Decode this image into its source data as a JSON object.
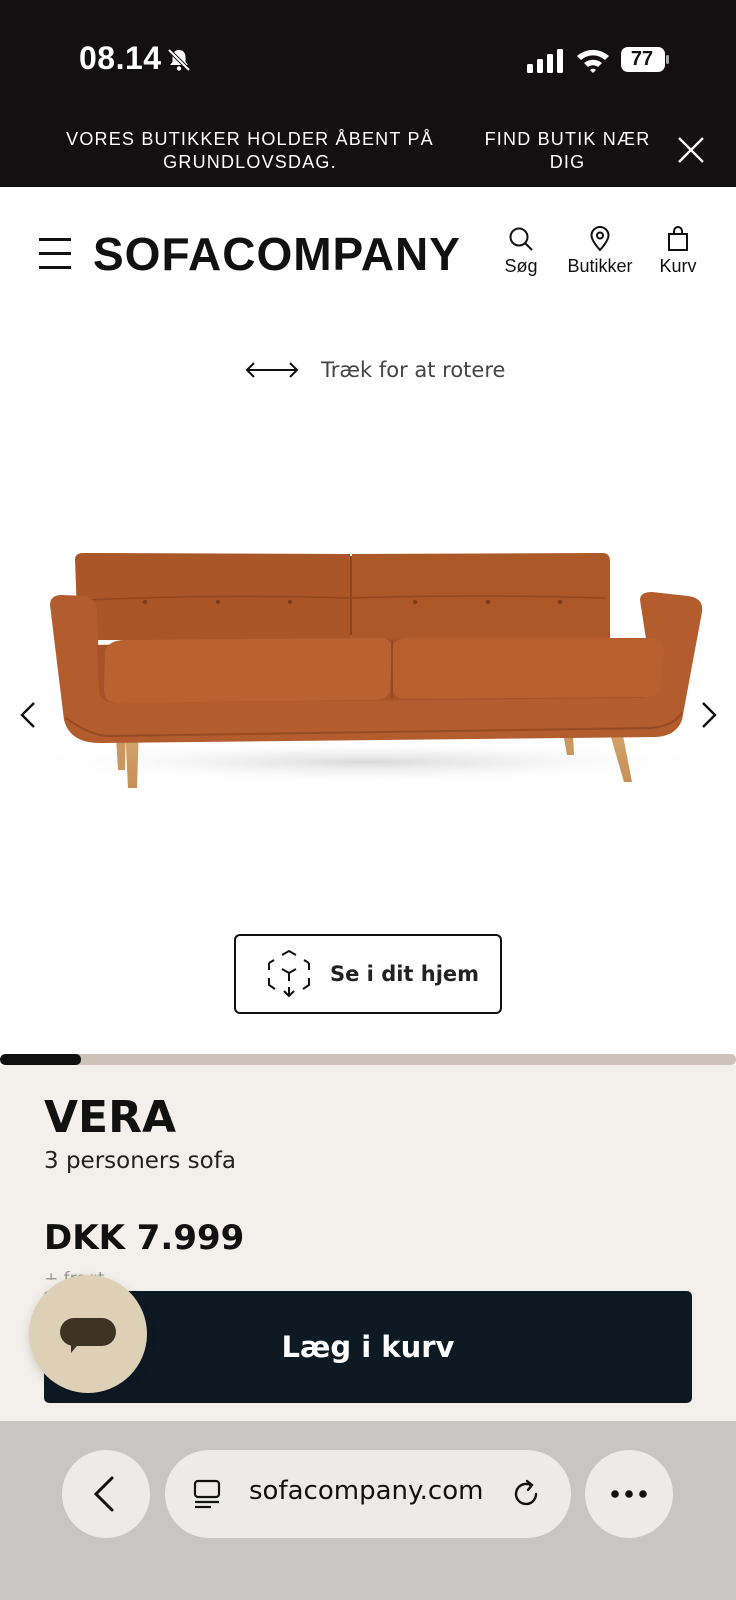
{
  "status_bar": {
    "time": "08.14",
    "battery": "77"
  },
  "banner": {
    "message": "VORES BUTIKKER HOLDER ÅBENT PÅ GRUNDLOVSDAG.",
    "find_store": "FIND BUTIK NÆR DIG"
  },
  "header": {
    "logo": "SOFACOMPANY",
    "search_label": "Søg",
    "stores_label": "Butikker",
    "cart_label": "Kurv"
  },
  "viewer": {
    "rotate_hint": "Træk for at rotere",
    "ar_button_label": "Se i dit hjem",
    "gallery_progress": 0.11
  },
  "product": {
    "name": "VERA",
    "type": "3 personers sofa",
    "price": "DKK 7.999",
    "price_note": "+ fragt",
    "add_to_cart": "Læg i kurv",
    "color": "#b05a2c"
  },
  "browser": {
    "url": "sofacompany.com"
  }
}
